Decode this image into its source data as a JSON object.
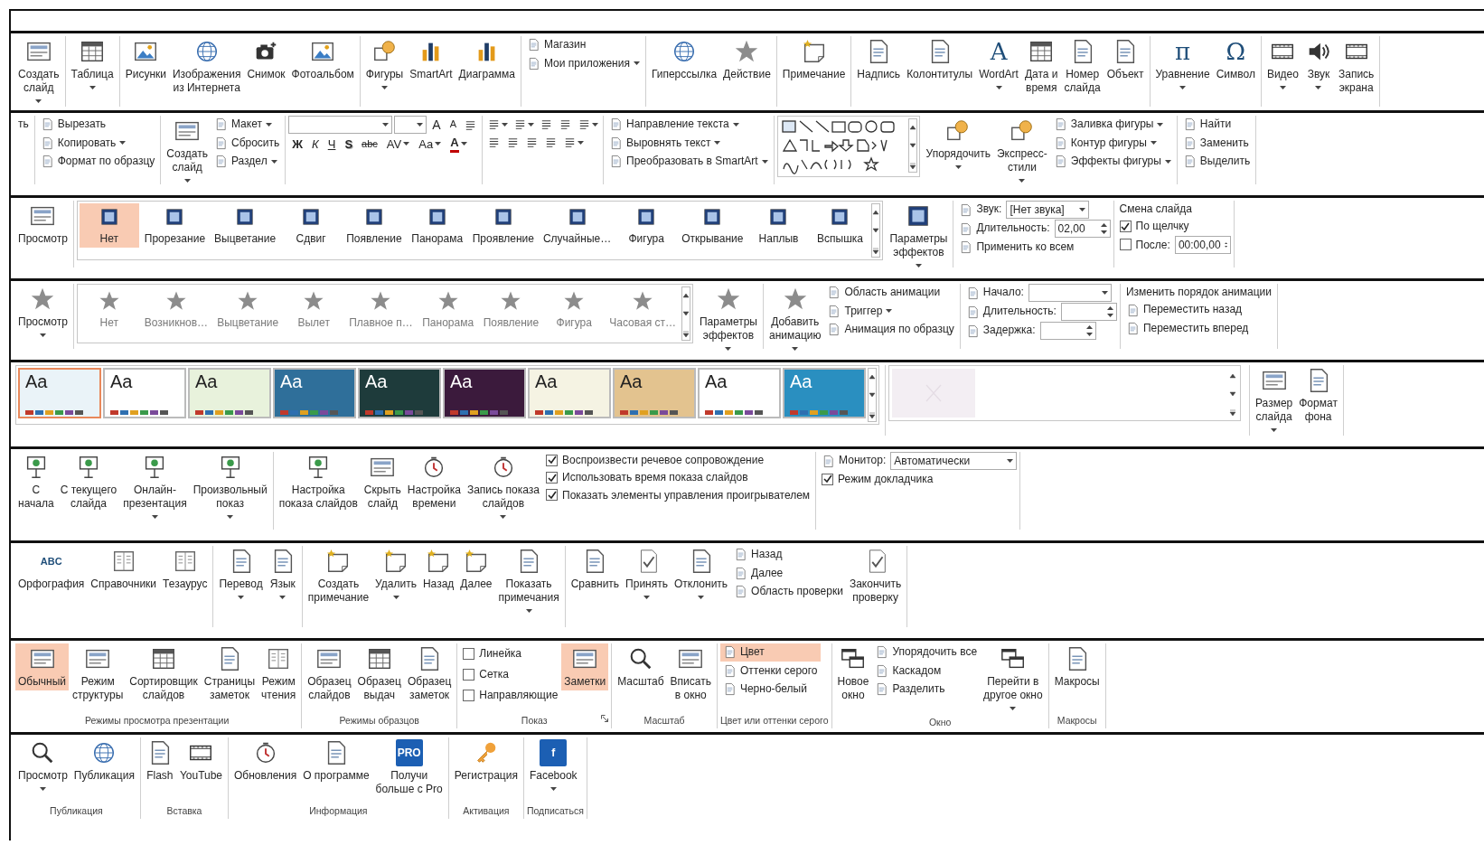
{
  "strips": [
    {
      "groups": [
        {
          "items": [
            {
              "kind": "large",
              "label": [
                "Создать",
                "слайд"
              ],
              "dropdown": true
            }
          ]
        },
        {
          "items": [
            {
              "kind": "large",
              "label": [
                "Таблица"
              ],
              "dropdown": true
            }
          ]
        },
        {
          "items": [
            {
              "kind": "large",
              "label": [
                "Рисунки"
              ]
            },
            {
              "kind": "large",
              "label": [
                "Изображения",
                "из Интернета"
              ]
            },
            {
              "kind": "large",
              "label": [
                "Снимок"
              ]
            },
            {
              "kind": "large",
              "label": [
                "Фотоальбом"
              ]
            }
          ]
        },
        {
          "items": [
            {
              "kind": "large",
              "label": [
                "Фигуры"
              ],
              "dropdown": true
            },
            {
              "kind": "large",
              "label": [
                "SmartArt"
              ]
            },
            {
              "kind": "large",
              "label": [
                "Диаграмма"
              ]
            }
          ]
        },
        {
          "items": [
            {
              "kind": "stack",
              "items": [
                {
                  "kind": "small",
                  "label": "Магазин"
                },
                {
                  "kind": "small",
                  "label": "Мои приложения",
                  "dropdown": true
                }
              ]
            }
          ]
        },
        {
          "items": [
            {
              "kind": "large",
              "label": [
                "Гиперссылка"
              ]
            },
            {
              "kind": "large",
              "label": [
                "Действие"
              ]
            }
          ]
        },
        {
          "items": [
            {
              "kind": "large",
              "label": [
                "Примечание"
              ]
            }
          ]
        },
        {
          "items": [
            {
              "kind": "large",
              "label": [
                "Надпись"
              ]
            },
            {
              "kind": "large",
              "label": [
                "Колонтитулы"
              ]
            },
            {
              "kind": "large",
              "label": [
                "WordArt"
              ],
              "icon_text": "A",
              "dropdown": true
            },
            {
              "kind": "large",
              "label": [
                "Дата и",
                "время"
              ]
            },
            {
              "kind": "large",
              "label": [
                "Номер",
                "слайда"
              ]
            },
            {
              "kind": "large",
              "label": [
                "Объект"
              ]
            }
          ]
        },
        {
          "items": [
            {
              "kind": "large",
              "label": [
                "Уравнение"
              ],
              "icon_text": "π",
              "dropdown": true
            },
            {
              "kind": "large",
              "label": [
                "Символ"
              ],
              "icon_text": "Ω"
            }
          ]
        },
        {
          "items": [
            {
              "kind": "large",
              "label": [
                "Видео"
              ],
              "dropdown": true
            },
            {
              "kind": "large",
              "label": [
                "Звук"
              ],
              "dropdown": true
            },
            {
              "kind": "large",
              "label": [
                "Запись",
                "экрана"
              ]
            }
          ]
        }
      ]
    },
    {
      "groups": [
        {
          "items": [
            {
              "kind": "text",
              "label": "ть"
            }
          ]
        },
        {
          "items": [
            {
              "kind": "stack",
              "items": [
                {
                  "kind": "small",
                  "label": "Вырезать"
                },
                {
                  "kind": "small",
                  "label": "Копировать",
                  "dropdown": true
                },
                {
                  "kind": "small",
                  "label": "Формат по образцу"
                }
              ]
            }
          ]
        },
        {
          "items": [
            {
              "kind": "large",
              "label": [
                "Создать",
                "слайд"
              ],
              "dropdown": true
            },
            {
              "kind": "stack",
              "items": [
                {
                  "kind": "small",
                  "label": "Макет",
                  "dropdown": true
                },
                {
                  "kind": "small",
                  "label": "Сбросить"
                },
                {
                  "kind": "small",
                  "label": "Раздел",
                  "dropdown": true
                }
              ]
            }
          ]
        },
        {
          "items": [
            {
              "kind": "stack",
              "items": [
                {
                  "kind": "row",
                  "items": [
                    {
                      "kind": "combo"
                    },
                    {
                      "kind": "combo"
                    },
                    {
                      "kind": "glyph",
                      "label": "A"
                    },
                    {
                      "kind": "glyph",
                      "label": "A"
                    },
                    {
                      "kind": "iconbtn"
                    }
                  ]
                },
                {
                  "kind": "row",
                  "items": [
                    {
                      "kind": "glyph",
                      "label": "Ж"
                    },
                    {
                      "kind": "glyph",
                      "label": "К"
                    },
                    {
                      "kind": "glyph",
                      "label": "Ч"
                    },
                    {
                      "kind": "glyph",
                      "label": "S"
                    },
                    {
                      "kind": "glyph",
                      "label": "abc"
                    },
                    {
                      "kind": "glyph",
                      "label": "AV",
                      "dropdown": true
                    },
                    {
                      "kind": "glyph",
                      "label": "Aa",
                      "dropdown": true
                    },
                    {
                      "kind": "glyph",
                      "label": "A",
                      "dropdown": true
                    }
                  ]
                }
              ]
            }
          ]
        },
        {
          "items": [
            {
              "kind": "stack",
              "items": [
                {
                  "kind": "row",
                  "items": [
                    {
                      "kind": "iconbtn",
                      "dropdown": true
                    },
                    {
                      "kind": "iconbtn",
                      "dropdown": true
                    },
                    {
                      "kind": "iconbtn"
                    },
                    {
                      "kind": "iconbtn"
                    },
                    {
                      "kind": "iconbtn",
                      "dropdown": true
                    }
                  ]
                },
                {
                  "kind": "row",
                  "items": [
                    {
                      "kind": "iconbtn"
                    },
                    {
                      "kind": "iconbtn"
                    },
                    {
                      "kind": "iconbtn"
                    },
                    {
                      "kind": "iconbtn"
                    },
                    {
                      "kind": "iconbtn",
                      "dropdown": true
                    }
                  ]
                }
              ]
            }
          ]
        },
        {
          "items": [
            {
              "kind": "stack",
              "items": [
                {
                  "kind": "small",
                  "label": "Направление текста",
                  "dropdown": true
                },
                {
                  "kind": "small",
                  "label": "Выровнять текст",
                  "dropdown": true
                },
                {
                  "kind": "small",
                  "label": "Преобразовать в SmartArt",
                  "dropdown": true
                }
              ]
            }
          ]
        },
        {
          "items": [
            {
              "kind": "shapes"
            },
            {
              "kind": "large",
              "label": [
                "Упорядочить"
              ],
              "dropdown": true
            },
            {
              "kind": "large",
              "label": [
                "Экспресс-",
                "стили"
              ],
              "dropdown": true
            },
            {
              "kind": "stack",
              "items": [
                {
                  "kind": "small",
                  "label": "Заливка фигуры",
                  "dropdown": true
                },
                {
                  "kind": "small",
                  "label": "Контур фигуры",
                  "dropdown": true
                },
                {
                  "kind": "small",
                  "label": "Эффекты фигуры",
                  "dropdown": true
                }
              ]
            }
          ]
        },
        {
          "items": [
            {
              "kind": "stack",
              "items": [
                {
                  "kind": "small",
                  "label": "Найти"
                },
                {
                  "kind": "small",
                  "label": "Заменить"
                },
                {
                  "kind": "small",
                  "label": "Выделить"
                }
              ]
            }
          ]
        }
      ]
    },
    {
      "groups": [
        {
          "items": [
            {
              "kind": "large",
              "label": [
                "Просмотр"
              ]
            }
          ]
        },
        {
          "items": [
            {
              "kind": "gallery",
              "tiles": [
                {
                  "kind": "transition",
                  "label": "Нет",
                  "selected": true
                },
                {
                  "kind": "transition",
                  "label": "Прорезание",
                  "selected": false
                },
                {
                  "kind": "transition",
                  "label": "Выцветание",
                  "selected": false
                },
                {
                  "kind": "transition",
                  "label": "Сдвиг",
                  "selected": false
                },
                {
                  "kind": "transition",
                  "label": "Появление",
                  "selected": false
                },
                {
                  "kind": "transition",
                  "label": "Панорама",
                  "selected": false
                },
                {
                  "kind": "transition",
                  "label": "Проявление",
                  "selected": false
                },
                {
                  "kind": "transition",
                  "label": "Случайные…",
                  "selected": false
                },
                {
                  "kind": "transition",
                  "label": "Фигура",
                  "selected": false
                },
                {
                  "kind": "transition",
                  "label": "Открывание",
                  "selected": false
                },
                {
                  "kind": "transition",
                  "label": "Наплыв",
                  "selected": false
                },
                {
                  "kind": "transition",
                  "label": "Вспышка",
                  "selected": false
                }
              ]
            },
            {
              "kind": "large",
              "label": [
                "Параметры",
                "эффектов"
              ],
              "dropdown": true
            }
          ]
        },
        {
          "items": [
            {
              "kind": "stack",
              "items": [
                {
                  "kind": "row",
                  "items": [
                    {
                      "kind": "small",
                      "label": "Звук:"
                    },
                    {
                      "kind": "combo",
                      "value": "[Нет звука]"
                    }
                  ]
                },
                {
                  "kind": "row",
                  "items": [
                    {
                      "kind": "small",
                      "label": "Длительность:"
                    },
                    {
                      "kind": "spin",
                      "value": "02,00"
                    }
                  ]
                },
                {
                  "kind": "small",
                  "label": "Применить ко всем"
                }
              ]
            }
          ]
        },
        {
          "items": [
            {
              "kind": "stack",
              "items": [
                {
                  "kind": "text",
                  "label": "Смена слайда"
                },
                {
                  "kind": "check",
                  "label": "По щелчку",
                  "checked": true
                },
                {
                  "kind": "row",
                  "items": [
                    {
                      "kind": "check",
                      "label": "После:",
                      "checked": false
                    },
                    {
                      "kind": "spin",
                      "value": "00:00,00"
                    }
                  ]
                }
              ]
            }
          ]
        }
      ]
    },
    {
      "groups": [
        {
          "items": [
            {
              "kind": "large",
              "label": [
                "Просмотр"
              ],
              "dropdown": true
            }
          ]
        },
        {
          "items": [
            {
              "kind": "gallery",
              "tiles": [
                {
                  "kind": "animation",
                  "label": "Нет"
                },
                {
                  "kind": "animation",
                  "label": "Возникнов…"
                },
                {
                  "kind": "animation",
                  "label": "Выцветание"
                },
                {
                  "kind": "animation",
                  "label": "Вылет"
                },
                {
                  "kind": "animation",
                  "label": "Плавное п…"
                },
                {
                  "kind": "animation",
                  "label": "Панорама"
                },
                {
                  "kind": "animation",
                  "label": "Появление"
                },
                {
                  "kind": "animation",
                  "label": "Фигура"
                },
                {
                  "kind": "animation",
                  "label": "Часовая ст…"
                }
              ]
            },
            {
              "kind": "large",
              "label": [
                "Параметры",
                "эффектов"
              ],
              "dropdown": true
            }
          ]
        },
        {
          "items": [
            {
              "kind": "large",
              "label": [
                "Добавить",
                "анимацию"
              ],
              "dropdown": true
            },
            {
              "kind": "stack",
              "items": [
                {
                  "kind": "small",
                  "label": "Область анимации"
                },
                {
                  "kind": "small",
                  "label": "Триггер",
                  "dropdown": true
                },
                {
                  "kind": "small",
                  "label": "Анимация по образцу"
                }
              ]
            }
          ]
        },
        {
          "items": [
            {
              "kind": "stack",
              "items": [
                {
                  "kind": "row",
                  "items": [
                    {
                      "kind": "small",
                      "label": "Начало:"
                    },
                    {
                      "kind": "combo"
                    }
                  ]
                },
                {
                  "kind": "row",
                  "items": [
                    {
                      "kind": "small",
                      "label": "Длительность:"
                    },
                    {
                      "kind": "spin"
                    }
                  ]
                },
                {
                  "kind": "row",
                  "items": [
                    {
                      "kind": "small",
                      "label": "Задержка:"
                    },
                    {
                      "kind": "spin"
                    }
                  ]
                }
              ]
            }
          ]
        },
        {
          "items": [
            {
              "kind": "stack",
              "items": [
                {
                  "kind": "text",
                  "label": "Изменить порядок анимации"
                },
                {
                  "kind": "small",
                  "label": "Переместить назад"
                },
                {
                  "kind": "small",
                  "label": "Переместить вперед"
                }
              ]
            }
          ]
        }
      ]
    },
    {
      "groups": [
        {
          "items": [
            {
              "kind": "gallery",
              "tiles": [
                {
                  "kind": "theme",
                  "heading": "Aa",
                  "color": "#eaf3f8",
                  "selected": true
                },
                {
                  "kind": "theme",
                  "heading": "Aa",
                  "color": "#ffffff",
                  "selected": false
                },
                {
                  "kind": "theme",
                  "heading": "Aa",
                  "color": "#e8f2dc",
                  "selected": false
                },
                {
                  "kind": "theme",
                  "heading": "Aa",
                  "color": "#2f6f9a",
                  "selected": false
                },
                {
                  "kind": "theme",
                  "heading": "Aa",
                  "color": "#1e3b3b",
                  "selected": false
                },
                {
                  "kind": "theme",
                  "heading": "Aa",
                  "color": "#3b1a3c",
                  "selected": false
                },
                {
                  "kind": "theme",
                  "heading": "Aa",
                  "color": "#f5f3e3",
                  "selected": false
                },
                {
                  "kind": "theme",
                  "heading": "Aa",
                  "color": "#e3c38f",
                  "selected": false
                },
                {
                  "kind": "theme",
                  "heading": "Aa",
                  "color": "#ffffff",
                  "selected": false
                },
                {
                  "kind": "theme",
                  "heading": "Aa",
                  "color": "#2a8fc0",
                  "selected": false
                }
              ]
            }
          ]
        },
        {
          "items": [
            {
              "kind": "variants"
            }
          ]
        },
        {
          "items": [
            {
              "kind": "large",
              "label": [
                "Размер",
                "слайда"
              ],
              "dropdown": true
            },
            {
              "kind": "large",
              "label": [
                "Формат",
                "фона"
              ]
            }
          ]
        }
      ]
    },
    {
      "groups": [
        {
          "items": [
            {
              "kind": "large",
              "label": [
                "С",
                "начала"
              ]
            },
            {
              "kind": "large",
              "label": [
                "С текущего",
                "слайда"
              ]
            },
            {
              "kind": "large",
              "label": [
                "Онлайн-",
                "презентация"
              ],
              "dropdown": true
            },
            {
              "kind": "large",
              "label": [
                "Произвольный",
                "показ"
              ],
              "dropdown": true
            }
          ]
        },
        {
          "items": [
            {
              "kind": "large",
              "label": [
                "Настройка",
                "показа слайдов"
              ]
            },
            {
              "kind": "large",
              "label": [
                "Скрыть",
                "слайд"
              ]
            },
            {
              "kind": "large",
              "label": [
                "Настройка",
                "времени"
              ]
            },
            {
              "kind": "large",
              "label": [
                "Запись показа",
                "слайдов"
              ],
              "dropdown": true
            },
            {
              "kind": "stack",
              "items": [
                {
                  "kind": "check",
                  "label": "Воспроизвести речевое сопровождение",
                  "checked": true
                },
                {
                  "kind": "check",
                  "label": "Использовать время показа слайдов",
                  "checked": true
                },
                {
                  "kind": "check",
                  "label": "Показать элементы управления проигрывателем",
                  "checked": true
                }
              ]
            }
          ]
        },
        {
          "items": [
            {
              "kind": "stack",
              "items": [
                {
                  "kind": "row",
                  "items": [
                    {
                      "kind": "small",
                      "label": "Монитор:"
                    },
                    {
                      "kind": "combo",
                      "value": "Автоматически"
                    }
                  ]
                },
                {
                  "kind": "check",
                  "label": "Режим докладчика",
                  "checked": true
                }
              ]
            }
          ]
        }
      ]
    },
    {
      "groups": [
        {
          "items": [
            {
              "kind": "large",
              "label": [
                "Орфография"
              ],
              "icon_text": "ABC"
            },
            {
              "kind": "large",
              "label": [
                "Справочники"
              ]
            },
            {
              "kind": "large",
              "label": [
                "Тезаурус"
              ]
            }
          ]
        },
        {
          "items": [
            {
              "kind": "large",
              "label": [
                "Перевод"
              ],
              "dropdown": true
            },
            {
              "kind": "large",
              "label": [
                "Язык"
              ],
              "dropdown": true
            }
          ]
        },
        {
          "items": [
            {
              "kind": "large",
              "label": [
                "Создать",
                "примечание"
              ]
            },
            {
              "kind": "large",
              "label": [
                "Удалить"
              ],
              "dropdown": true
            },
            {
              "kind": "large",
              "label": [
                "Назад"
              ]
            },
            {
              "kind": "large",
              "label": [
                "Далее"
              ]
            },
            {
              "kind": "large",
              "label": [
                "Показать",
                "примечания"
              ],
              "dropdown": true
            }
          ]
        },
        {
          "items": [
            {
              "kind": "large",
              "label": [
                "Сравнить"
              ]
            },
            {
              "kind": "large",
              "label": [
                "Принять"
              ],
              "dropdown": true
            },
            {
              "kind": "large",
              "label": [
                "Отклонить"
              ],
              "dropdown": true
            },
            {
              "kind": "stack",
              "items": [
                {
                  "kind": "small",
                  "label": "Назад"
                },
                {
                  "kind": "small",
                  "label": "Далее"
                },
                {
                  "kind": "small",
                  "label": "Область проверки"
                }
              ]
            },
            {
              "kind": "large",
              "label": [
                "Закончить",
                "проверку"
              ]
            }
          ]
        }
      ]
    },
    {
      "groups": [
        {
          "label": "Режимы просмотра презентации",
          "items": [
            {
              "kind": "large",
              "label": [
                "Обычный"
              ],
              "selected": true
            },
            {
              "kind": "large",
              "label": [
                "Режим",
                "структуры"
              ],
              "selected": false
            },
            {
              "kind": "large",
              "label": [
                "Сортировщик",
                "слайдов"
              ],
              "selected": false
            },
            {
              "kind": "large",
              "label": [
                "Страницы",
                "заметок"
              ],
              "selected": false
            },
            {
              "kind": "large",
              "label": [
                "Режим",
                "чтения"
              ],
              "selected": false
            }
          ]
        },
        {
          "label": "Режимы образцов",
          "items": [
            {
              "kind": "large",
              "label": [
                "Образец",
                "слайдов"
              ]
            },
            {
              "kind": "large",
              "label": [
                "Образец",
                "выдач"
              ]
            },
            {
              "kind": "large",
              "label": [
                "Образец",
                "заметок"
              ]
            }
          ]
        },
        {
          "label": "Показ",
          "launcher": true,
          "items": [
            {
              "kind": "stack",
              "items": [
                {
                  "kind": "check",
                  "label": "Линейка",
                  "checked": false
                },
                {
                  "kind": "check",
                  "label": "Сетка",
                  "checked": false
                },
                {
                  "kind": "check",
                  "label": "Направляющие",
                  "checked": false
                }
              ]
            },
            {
              "kind": "large",
              "label": [
                "Заметки"
              ],
              "selected": true
            }
          ]
        },
        {
          "label": "Масштаб",
          "items": [
            {
              "kind": "large",
              "label": [
                "Масштаб"
              ]
            },
            {
              "kind": "large",
              "label": [
                "Вписать",
                "в окно"
              ]
            }
          ]
        },
        {
          "label": "Цвет или оттенки серого",
          "items": [
            {
              "kind": "stack",
              "items": [
                {
                  "kind": "small",
                  "label": "Цвет",
                  "selected": true
                },
                {
                  "kind": "small",
                  "label": "Оттенки серого",
                  "selected": false
                },
                {
                  "kind": "small",
                  "label": "Черно-белый",
                  "selected": false
                }
              ]
            }
          ]
        },
        {
          "label": "Окно",
          "items": [
            {
              "kind": "large",
              "label": [
                "Новое",
                "окно"
              ]
            },
            {
              "kind": "stack",
              "items": [
                {
                  "kind": "small",
                  "label": "Упорядочить все"
                },
                {
                  "kind": "small",
                  "label": "Каскадом"
                },
                {
                  "kind": "small",
                  "label": "Разделить"
                }
              ]
            },
            {
              "kind": "large",
              "label": [
                "Перейти в",
                "другое окно"
              ],
              "dropdown": true
            }
          ]
        },
        {
          "label": "Макросы",
          "items": [
            {
              "kind": "large",
              "label": [
                "Макросы"
              ]
            }
          ]
        }
      ]
    },
    {
      "groups": [
        {
          "label": "Публикация",
          "items": [
            {
              "kind": "large",
              "label": [
                "Просмотр"
              ],
              "dropdown": true
            },
            {
              "kind": "large",
              "label": [
                "Публикация"
              ]
            }
          ]
        },
        {
          "label": "Вставка",
          "items": [
            {
              "kind": "large",
              "label": [
                "Flash"
              ]
            },
            {
              "kind": "large",
              "label": [
                "YouTube"
              ]
            }
          ]
        },
        {
          "label": "Информация",
          "items": [
            {
              "kind": "large",
              "label": [
                "Обновления"
              ]
            },
            {
              "kind": "large",
              "label": [
                "О программе"
              ]
            },
            {
              "kind": "large",
              "label": [
                "Получи",
                "больше с Pro"
              ],
              "icon_text": "PRO"
            }
          ]
        },
        {
          "label": "Активация",
          "items": [
            {
              "kind": "large",
              "label": [
                "Регистрация"
              ]
            }
          ]
        },
        {
          "label": "Подписаться",
          "items": [
            {
              "kind": "large",
              "label": [
                "Facebook"
              ],
              "icon_text": "f",
              "dropdown": true
            }
          ]
        }
      ]
    }
  ]
}
